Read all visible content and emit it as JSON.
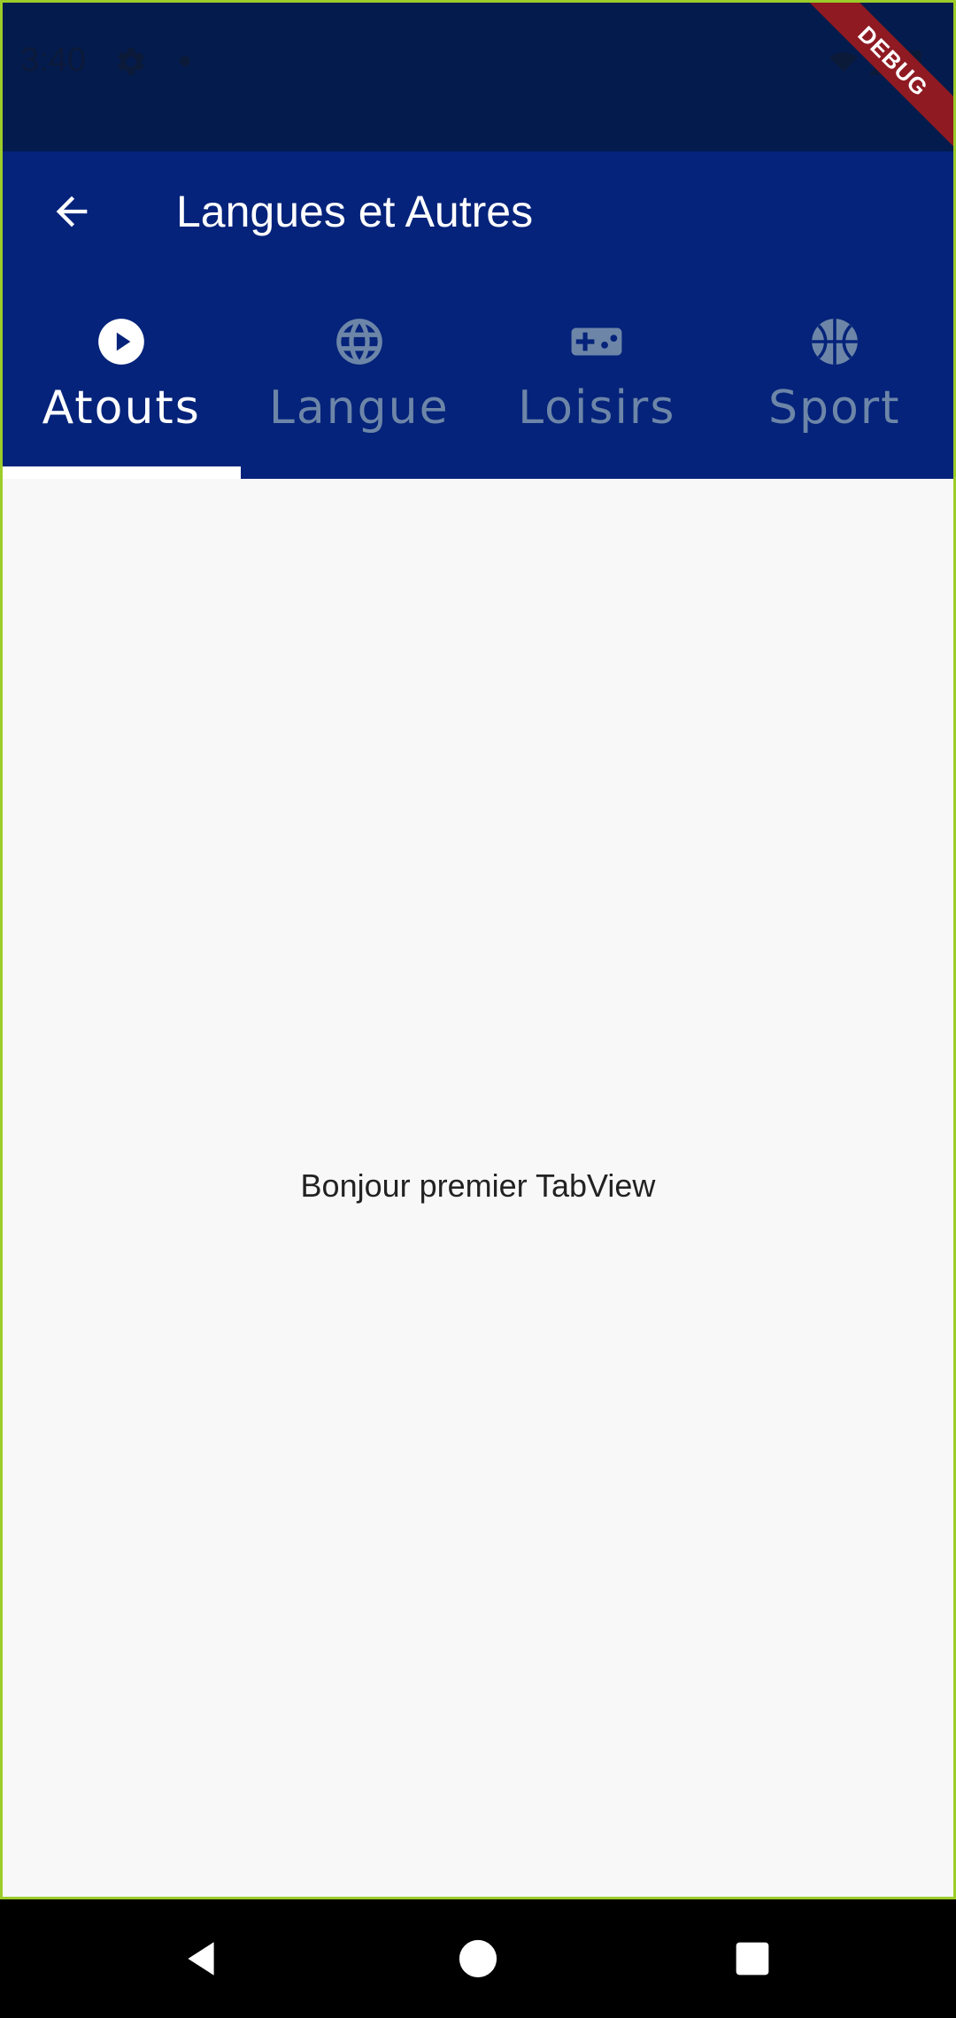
{
  "status_bar": {
    "time": "3:40",
    "icons": [
      "gear-icon",
      "notification-dot-icon",
      "wifi-off-icon",
      "signal-icon",
      "battery-icon"
    ]
  },
  "debug_banner": {
    "label": "DEBUG",
    "color": "#8f1a22"
  },
  "appbar": {
    "title": "Langues et Autres",
    "back_icon": "arrow-back-icon",
    "background": "#05237a"
  },
  "tabs": [
    {
      "label": "Atouts",
      "icon": "play-circle-icon",
      "selected": true
    },
    {
      "label": "Langue",
      "icon": "globe-icon",
      "selected": false
    },
    {
      "label": "Loisirs",
      "icon": "gamepad-icon",
      "selected": false
    },
    {
      "label": "Sport",
      "icon": "basketball-icon",
      "selected": false
    }
  ],
  "content": {
    "text": "Bonjour premier TabView"
  },
  "nav_bar": {
    "buttons": [
      "back-triangle-icon",
      "home-circle-icon",
      "recents-square-icon"
    ]
  },
  "colors": {
    "status_bar": "#041b4d",
    "tab_active": "#ffffff",
    "tab_inactive": "#6d86a8",
    "body_background": "#f8f8f9",
    "debug_border": "#9ccc2a"
  }
}
